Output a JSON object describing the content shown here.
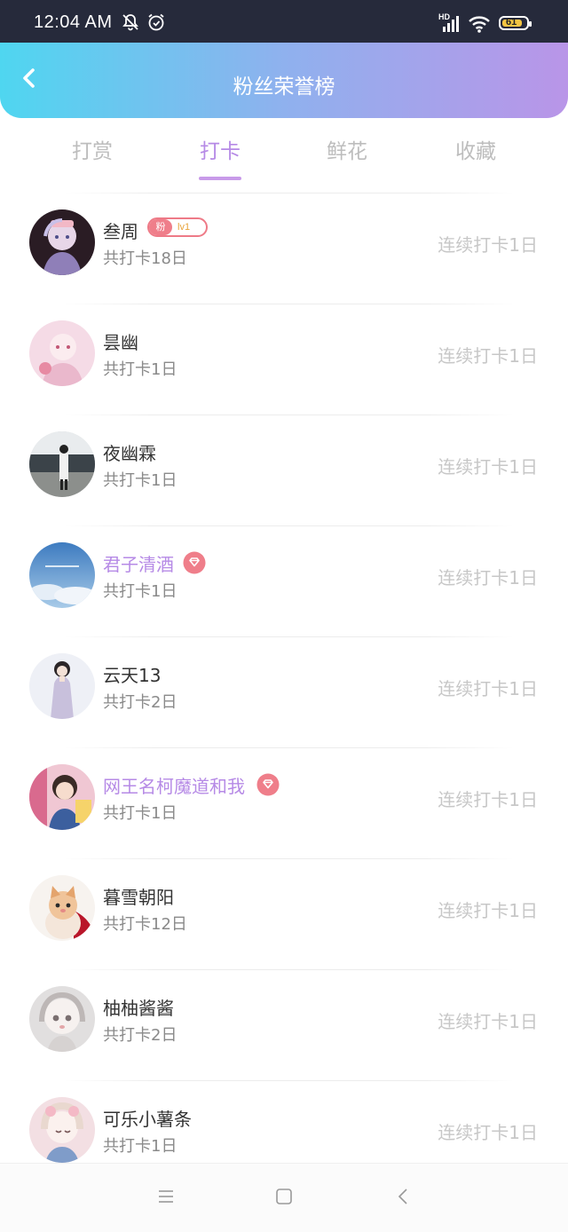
{
  "status_bar": {
    "time": "12:04 AM",
    "battery_level": "61",
    "network_label": "HD"
  },
  "header": {
    "title": "粉丝荣誉榜"
  },
  "tabs": [
    {
      "label": "打赏",
      "active": false
    },
    {
      "label": "打卡",
      "active": true
    },
    {
      "label": "鲜花",
      "active": false
    },
    {
      "label": "收藏",
      "active": false
    }
  ],
  "fans": [
    {
      "name": "叁周",
      "total": "共打卡18日",
      "streak": "连续打卡1日",
      "badge": {
        "fan": "粉",
        "level": "lv1"
      },
      "vip": false
    },
    {
      "name": "昙幽",
      "total": "共打卡1日",
      "streak": "连续打卡1日",
      "vip": false
    },
    {
      "name": "夜幽霖",
      "total": "共打卡1日",
      "streak": "连续打卡1日",
      "vip": false
    },
    {
      "name": "君子清酒",
      "total": "共打卡1日",
      "streak": "连续打卡1日",
      "vip": true
    },
    {
      "name": "云天13",
      "total": "共打卡2日",
      "streak": "连续打卡1日",
      "vip": false
    },
    {
      "name": "网王名柯魔道和我",
      "total": "共打卡1日",
      "streak": "连续打卡1日",
      "vip": true
    },
    {
      "name": "暮雪朝阳",
      "total": "共打卡12日",
      "streak": "连续打卡1日",
      "vip": false
    },
    {
      "name": "柚柚酱酱",
      "total": "共打卡2日",
      "streak": "连续打卡1日",
      "vip": false
    },
    {
      "name": "可乐小薯条",
      "total": "共打卡1日",
      "streak": "连续打卡1日",
      "vip": false
    }
  ],
  "colors": {
    "header_gradient_start": "#4fd6f0",
    "header_gradient_end": "#b995e8",
    "accent": "#b68ae6",
    "vip_badge": "#ef7e8a"
  },
  "icons": {
    "back": "chevron-left-icon",
    "vip": "diamond-icon",
    "nav": [
      "menu-icon",
      "home-square-icon",
      "back-triangle-icon"
    ]
  }
}
